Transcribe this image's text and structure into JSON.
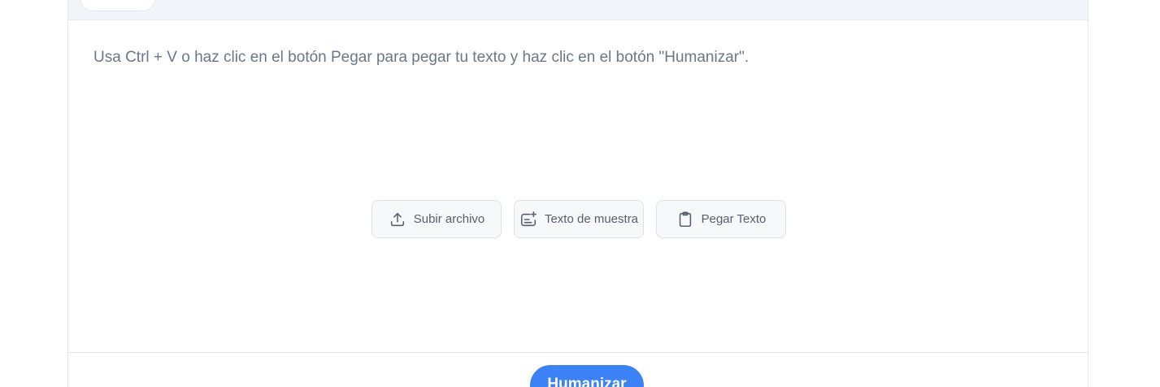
{
  "editor": {
    "placeholder": "Usa Ctrl + V o haz clic en el botón Pegar para pegar tu texto y haz clic en el botón \"Humanizar\"."
  },
  "actions": [
    {
      "label": "Subir archivo",
      "icon": "upload-icon"
    },
    {
      "label": "Texto de muestra",
      "icon": "sample-text-icon"
    },
    {
      "label": "Pegar Texto",
      "icon": "clipboard-icon"
    }
  ],
  "submit": {
    "label": "Humanizar"
  },
  "colors": {
    "accent": "#3b82f6",
    "topbar": "#f1f4f9",
    "placeholder_text": "#6b7787"
  }
}
